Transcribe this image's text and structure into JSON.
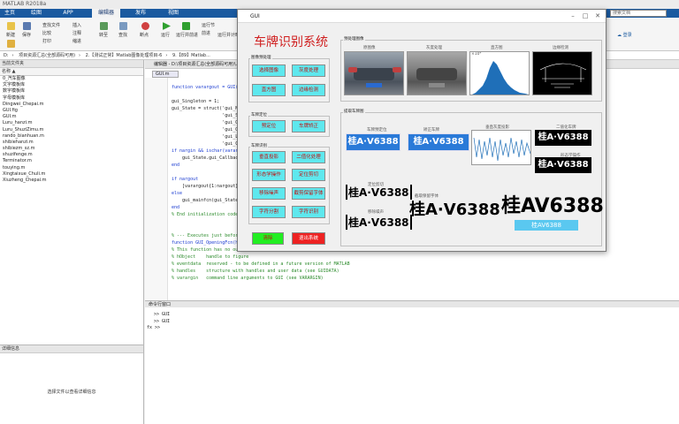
{
  "app": {
    "title": "MATLAB R2018a"
  },
  "menu_tabs": [
    "主页",
    "绘图",
    "APP",
    "编辑器",
    "发布",
    "视图"
  ],
  "search_placeholder": "搜索文档",
  "login_label": "登录",
  "ribbon": {
    "new": "新建",
    "open": "打开",
    "save": "保存",
    "find_files": "查找文件",
    "compare": "比较",
    "print": "打印",
    "insert": "插入",
    "comment": "注释",
    "indent": "缩进",
    "goto": "转至",
    "find": "查找",
    "breakpoint": "断点",
    "run": "运行",
    "run_advance": "运行并前进",
    "run_section": "运行节",
    "advance": "前进",
    "run_time": "运行并计时"
  },
  "address": [
    "D:",
    "项目资源汇总(全部源码可用)",
    "2.【测试正常】Matlab图像处理项目-6",
    "9.【89】Matlab..."
  ],
  "editor_path": "编辑器 - D:\\项目资源汇总(全部源码可用)\\...\\GUI.m",
  "editor_tab": "GUI.m",
  "current_folder": {
    "title": "当前文件夹",
    "column": "名称 ▲",
    "files": [
      "0_汽车图像",
      "文字模板库",
      "数字模板库",
      "字母模板库",
      "Dingwei_Chepai.m",
      "GUI.fig",
      "GUI.m",
      "Luru_hanzi.m",
      "Luru_ShuziZimu.m",
      "rando_bianhuan.m",
      "shibiehanzi.m",
      "shibiezm_sz.m",
      "shuzifenge.m",
      "Terminator.m",
      "touying.m",
      "Xingtaixue_Chuli.m",
      "Xiuzheng_Chepai.m"
    ]
  },
  "details": {
    "title": "详细信息",
    "hint": "选择文件以查看详细信息"
  },
  "code": [
    "function varargout = GUI(varargin)",
    "",
    "gui_Singleton = 1;",
    "gui_State = struct('gui_Name',       mfilename, ...",
    "                   'gui_Singleton',  gui_Singleton, ...",
    "                   'gui_OpeningFcn', @GUI_OpeningFcn, ...",
    "                   'gui_OutputFcn',  @GUI_OutputFcn, ...",
    "                   'gui_LayoutFcn',  [] , ...",
    "                   'gui_Callback',   []);",
    "if nargin && ischar(varargin{1})",
    "    gui_State.gui_Callback = str2func(varargin{1});",
    "end",
    "",
    "if nargout",
    "    [varargout{1:nargout}] = gui_mainfcn(gui_State, varargin{:});",
    "else",
    "    gui_mainfcn(gui_State, varargin{:});",
    "end",
    "% End initialization code - DO NOT EDIT",
    "",
    "",
    "% --- Executes just before GUI is made visible.",
    "function GUI_OpeningFcn(hObject, eventdata, handles, varargin)",
    "% This function has no output args, see OutputFcn.",
    "% hObject    handle to figure",
    "% eventdata  reserved - to be defined in a future version of MATLAB",
    "% handles    structure with handles and user data (see GUIDATA)",
    "% varargin   command line arguments to GUI (see VARARGIN)"
  ],
  "command_window": {
    "title": "命令行窗口",
    "lines": [
      ">> GUI",
      ">> GUI"
    ],
    "prompt": "fx >>"
  },
  "gui": {
    "window_title": "GUI",
    "main_title": "车牌识别系统",
    "panel_preprocess": "图像预处理",
    "panel_locate": "车牌定位",
    "panel_recognize": "车牌识别",
    "btn_select": "选择图像",
    "btn_gray": "灰度处理",
    "btn_hist": "直方图",
    "btn_edge": "边缘检测",
    "btn_locate": "预定位",
    "btn_correct": "车牌矫正",
    "btn_crop": "垂直投影",
    "btn_binary": "二值化处理",
    "btn_morph": "形态学操作",
    "btn_precise": "定位剪切",
    "btn_remove": "移除噪声",
    "btn_hproj": "截剪保留字体",
    "btn_segment": "字符分割",
    "btn_recog": "字符识别",
    "btn_clear": "清除",
    "btn_exit": "退出系统",
    "section_pre": "预处理图像",
    "img_labels": [
      "原图像",
      "灰度处理",
      "直方图",
      "边缘检测"
    ],
    "hist_exp": "×10⁴",
    "section_recog": "提取车牌图",
    "rec_labels": [
      "车牌预定位",
      "矫正车牌",
      "垂直灰度投影",
      "二值化车牌",
      "形态学操作",
      "定位剪切",
      "截取保留字体",
      "移除噪声"
    ],
    "plate_text": "桂A·V6388",
    "bw_text": "桂A·V6388",
    "result_text": "桂AV6388",
    "big_text": "桂AV6388"
  },
  "colors": {
    "gui_button": "#5ee8ee",
    "clear_button": "#22ee22",
    "exit_button": "#ee2222",
    "title_red": "#d02020",
    "tab_blue": "#1a5aa0"
  }
}
